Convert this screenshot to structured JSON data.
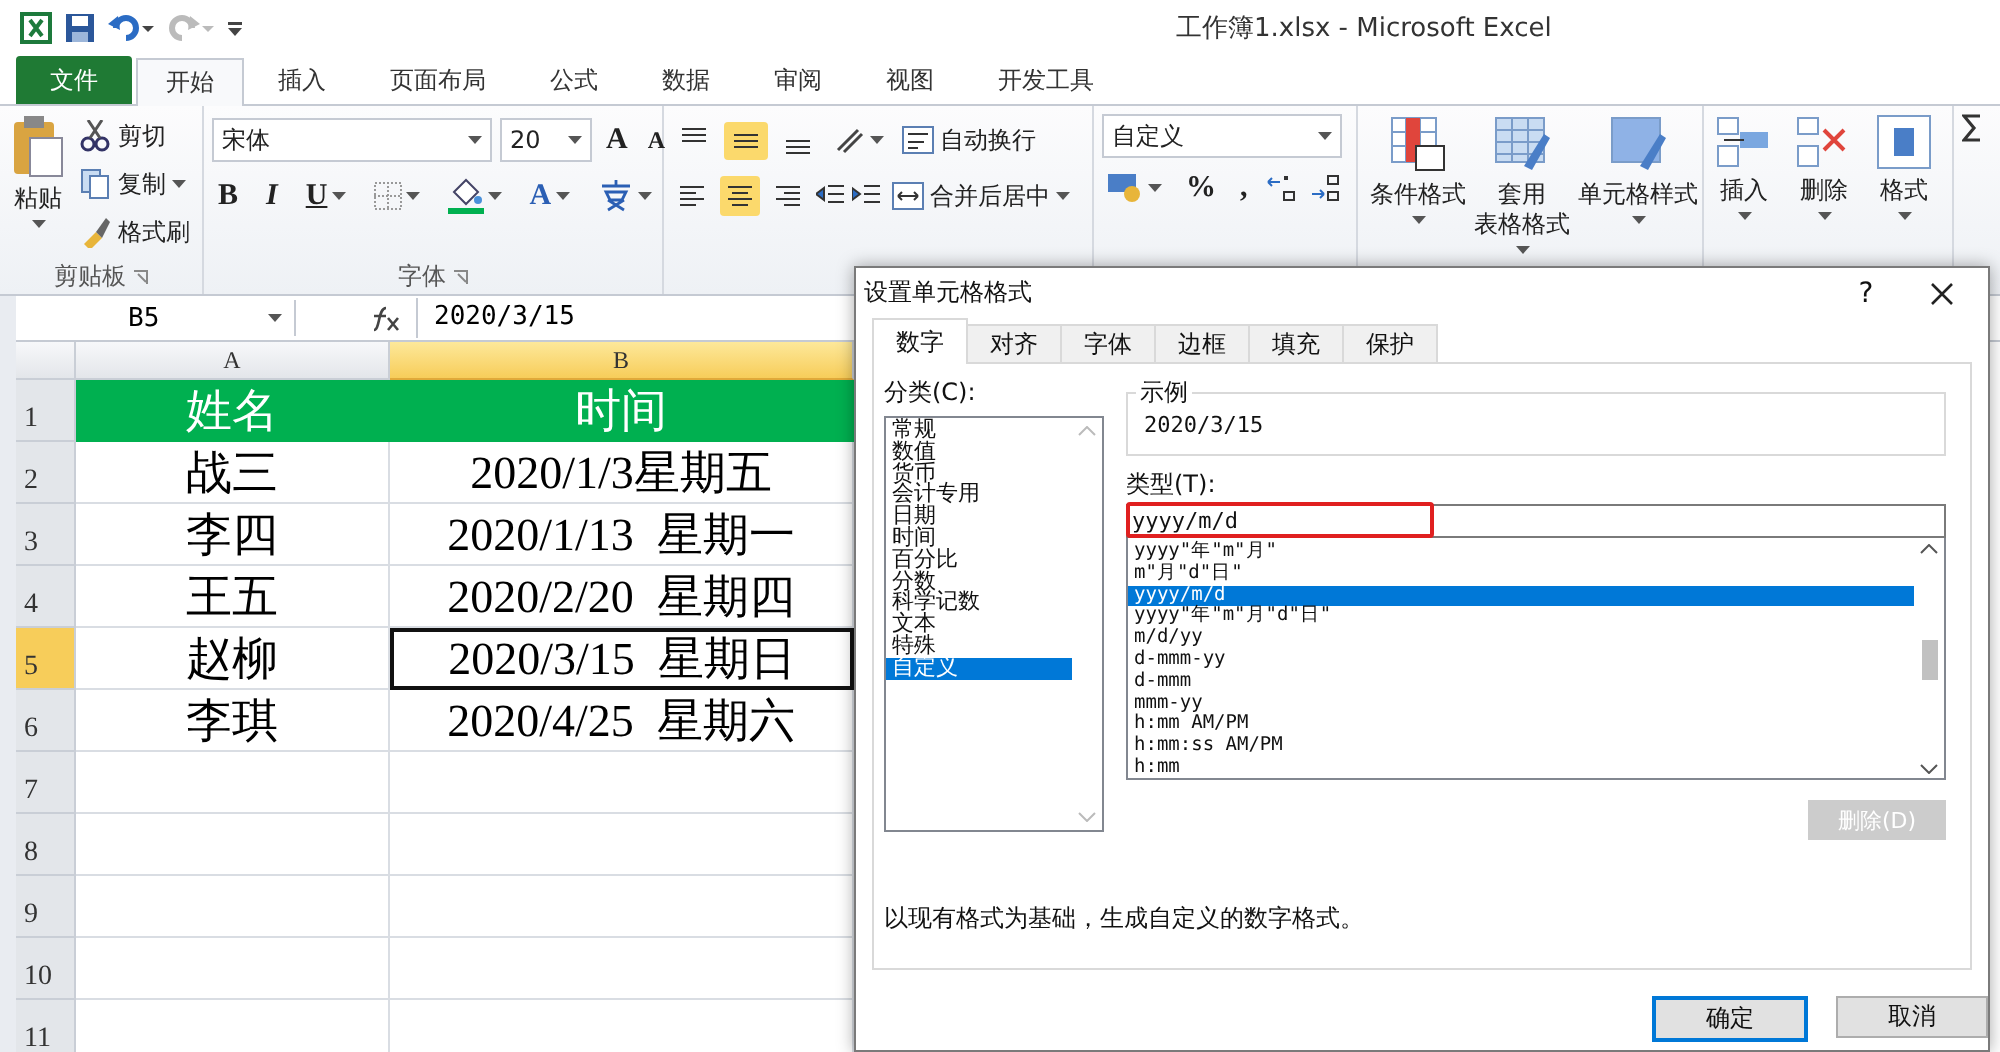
{
  "window": {
    "title": "工作簿1.xlsx  -  Microsoft Excel"
  },
  "ribbon_tabs": [
    {
      "label": "文件",
      "kind": "file",
      "selected": false
    },
    {
      "label": "开始",
      "kind": "tab",
      "selected": true
    },
    {
      "label": "插入",
      "kind": "tab",
      "selected": false
    },
    {
      "label": "页面布局",
      "kind": "tab",
      "selected": false
    },
    {
      "label": "公式",
      "kind": "tab",
      "selected": false
    },
    {
      "label": "数据",
      "kind": "tab",
      "selected": false
    },
    {
      "label": "审阅",
      "kind": "tab",
      "selected": false
    },
    {
      "label": "视图",
      "kind": "tab",
      "selected": false
    },
    {
      "label": "开发工具",
      "kind": "tab",
      "selected": false
    }
  ],
  "clipboard": {
    "paste": "粘贴",
    "cut": "剪切",
    "copy": "复制",
    "painter": "格式刷",
    "group": "剪贴板"
  },
  "font": {
    "name": "宋体",
    "size": "20",
    "grow": "A",
    "shrink": "A",
    "bold": "B",
    "italic": "I",
    "underline": "U",
    "color_button": "A",
    "group": "字体"
  },
  "alignment": {
    "vertical": [
      {
        "on": false
      },
      {
        "on": true
      },
      {
        "on": false
      }
    ],
    "horizontal": [
      {
        "on": false
      },
      {
        "on": true
      },
      {
        "on": false
      }
    ],
    "wrap": "自动换行",
    "merge": "合并后居中"
  },
  "number": {
    "format": "自定义",
    "percent": "%",
    "comma": ","
  },
  "styles": [
    {
      "lines": [
        "条件格式"
      ]
    },
    {
      "lines": [
        "套用",
        "表格格式"
      ]
    },
    {
      "lines": [
        "单元格样式"
      ]
    }
  ],
  "cells": [
    {
      "label": "插入"
    },
    {
      "label": "删除"
    },
    {
      "label": "格式"
    }
  ],
  "formula_bar": {
    "name_box": "B5",
    "value": "2020/3/15"
  },
  "sheet": {
    "columns": [
      {
        "label": "A",
        "selected": false
      },
      {
        "label": "B",
        "selected": true
      }
    ],
    "rows": [
      {
        "number": "1",
        "selected": false,
        "kind": "header",
        "cells": [
          {
            "text": "姓名",
            "active": false
          },
          {
            "text": "时间",
            "active": false
          }
        ]
      },
      {
        "number": "2",
        "selected": false,
        "kind": "data",
        "cells": [
          {
            "text": "战三",
            "active": false
          },
          {
            "text": "2020/1/3星期五",
            "active": false
          }
        ]
      },
      {
        "number": "3",
        "selected": false,
        "kind": "data",
        "cells": [
          {
            "text": "李四",
            "active": false
          },
          {
            "text": "2020/1/13  星期一",
            "active": false
          }
        ]
      },
      {
        "number": "4",
        "selected": false,
        "kind": "data",
        "cells": [
          {
            "text": "王五",
            "active": false
          },
          {
            "text": "2020/2/20  星期四",
            "active": false
          }
        ]
      },
      {
        "number": "5",
        "selected": true,
        "kind": "data",
        "cells": [
          {
            "text": "赵柳",
            "active": false
          },
          {
            "text": "2020/3/15  星期日",
            "active": true
          }
        ]
      },
      {
        "number": "6",
        "selected": false,
        "kind": "data",
        "cells": [
          {
            "text": "李琪",
            "active": false
          },
          {
            "text": "2020/4/25  星期六",
            "active": false
          }
        ]
      },
      {
        "number": "7",
        "selected": false,
        "kind": "data",
        "cells": []
      },
      {
        "number": "8",
        "selected": false,
        "kind": "data",
        "cells": []
      },
      {
        "number": "9",
        "selected": false,
        "kind": "data",
        "cells": []
      },
      {
        "number": "10",
        "selected": false,
        "kind": "data",
        "cells": []
      },
      {
        "number": "11",
        "selected": false,
        "kind": "data",
        "cells": []
      }
    ]
  },
  "dialog": {
    "title": "设置单元格格式",
    "help": "?",
    "tabs": [
      {
        "label": "数字",
        "selected": true
      },
      {
        "label": "对齐",
        "selected": false
      },
      {
        "label": "字体",
        "selected": false
      },
      {
        "label": "边框",
        "selected": false
      },
      {
        "label": "填充",
        "selected": false
      },
      {
        "label": "保护",
        "selected": false
      }
    ],
    "category_label": "分类(C):",
    "categories": [
      {
        "label": "常规",
        "selected": false
      },
      {
        "label": "数值",
        "selected": false
      },
      {
        "label": "货币",
        "selected": false
      },
      {
        "label": "会计专用",
        "selected": false
      },
      {
        "label": "日期",
        "selected": false
      },
      {
        "label": "时间",
        "selected": false
      },
      {
        "label": "百分比",
        "selected": false
      },
      {
        "label": "分数",
        "selected": false
      },
      {
        "label": "科学记数",
        "selected": false
      },
      {
        "label": "文本",
        "selected": false
      },
      {
        "label": "特殊",
        "selected": false
      },
      {
        "label": "自定义",
        "selected": true
      }
    ],
    "sample_label": "示例",
    "sample": "2020/3/15",
    "type_label": "类型(T):",
    "type_value": "yyyy/m/d",
    "type_highlighted": true,
    "formats": [
      {
        "label": "yyyy\"年\"m\"月\"",
        "selected": false
      },
      {
        "label": "m\"月\"d\"日\"",
        "selected": false
      },
      {
        "label": "yyyy/m/d",
        "selected": true
      },
      {
        "label": "yyyy\"年\"m\"月\"d\"日\"",
        "selected": false
      },
      {
        "label": "m/d/yy",
        "selected": false
      },
      {
        "label": "d-mmm-yy",
        "selected": false
      },
      {
        "label": "d-mmm",
        "selected": false
      },
      {
        "label": "mmm-yy",
        "selected": false
      },
      {
        "label": "h:mm AM/PM",
        "selected": false
      },
      {
        "label": "h:mm:ss AM/PM",
        "selected": false
      },
      {
        "label": "h:mm",
        "selected": false
      }
    ],
    "delete": {
      "label": "删除(D)",
      "disabled": true
    },
    "description": "以现有格式为基础，生成自定义的数字格式。",
    "buttons": [
      {
        "label": "确定",
        "kind": "default"
      },
      {
        "label": "取消",
        "kind": "normal"
      }
    ]
  }
}
